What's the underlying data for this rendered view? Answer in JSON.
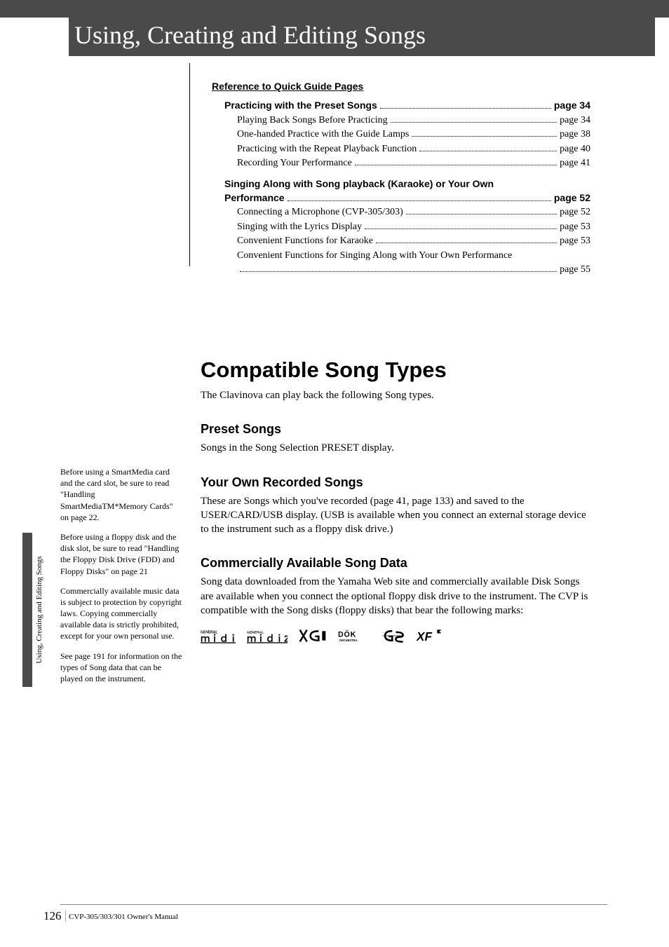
{
  "title": "Using, Creating and Editing Songs",
  "ref_title": "Reference to Quick Guide Pages",
  "group1_heading": {
    "label": "Practicing with the Preset Songs",
    "page": "page 34"
  },
  "group1": [
    {
      "label": "Playing Back Songs Before Practicing",
      "page": "page 34"
    },
    {
      "label": "One-handed Practice with the Guide Lamps",
      "page": "page 38"
    },
    {
      "label": "Practicing with the Repeat Playback Function",
      "page": "page 40"
    },
    {
      "label": "Recording Your Performance",
      "page": "page 41"
    }
  ],
  "group2_heading_wrap": "Singing Along with Song playback (Karaoke) or Your Own",
  "group2_heading_tail": {
    "label": "Performance",
    "page": "page 52"
  },
  "group2": [
    {
      "label": "Connecting a Microphone (CVP-305/303)",
      "page": "page 52"
    },
    {
      "label": "Singing with the Lyrics Display",
      "page": "page 53"
    },
    {
      "label": "Convenient Functions for Karaoke",
      "page": "page 53"
    }
  ],
  "group2_wrap_long": "Convenient Functions for Singing Along with Your Own Performance",
  "group2_wrap_long_page": "page 55",
  "main": {
    "h1": "Compatible Song Types",
    "intro": "The Clavinova can play back the following Song types.",
    "sections": [
      {
        "h2": "Preset Songs",
        "body": "Songs in the Song Selection PRESET display."
      },
      {
        "h2": "Your Own Recorded Songs",
        "body": "These are Songs which you've recorded (page 41, page 133) and saved to the USER/CARD/USB display. (USB is available when you connect an external storage device to the instrument such as a floppy disk drive.)"
      },
      {
        "h2": "Commercially Available Song Data",
        "body": "Song data downloaded from the Yamaha Web site and commercially available Disk Songs are available when you connect the optional floppy disk drive to the instrument. The CVP is compatible with the Song disks (floppy disks) that bear the following marks:"
      }
    ]
  },
  "side": [
    "Before using a SmartMedia card and the card slot, be sure to read \"Handling SmartMediaTM*Memory Cards\" on page 22.",
    "Before using a floppy disk and the disk slot, be sure to read \"Handling the Floppy Disk Drive (FDD) and Floppy Disks\" on page 21",
    "Commercially available music data is subject to protection by copyright laws. Copying commercially available data is strictly prohibited, except for your own personal use.",
    "See page 191 for information on the types of Song data that can be played on the instrument."
  ],
  "vtext": "Using, Creating and Editing Songs",
  "page_num": "126",
  "footer": "CVP-305/303/301 Owner's Manual",
  "logos": {
    "gm": "GENERAL MIDI",
    "gm2": "GENERAL MIDI 2",
    "xg": "XG",
    "disk": "DISK ORCHESTRA",
    "gs": "GS",
    "xf": "XF"
  }
}
